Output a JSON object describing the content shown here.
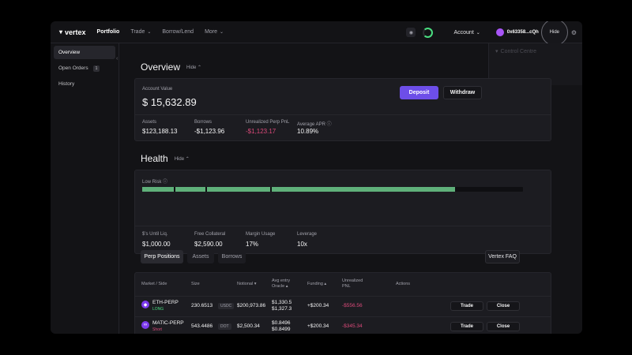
{
  "logo": "vertex",
  "nav": {
    "portfolio": "Portfolio",
    "trade": "Trade",
    "borrow_lend": "Borrow/Lend",
    "more": "More"
  },
  "header": {
    "account": "Account",
    "wallet": "0x63358...cQh",
    "hide": "Hide"
  },
  "dropdown": {
    "control_centre": "Control Centre"
  },
  "sidebar": {
    "items": [
      {
        "label": "Overview"
      },
      {
        "label": "Open Orders",
        "badge": "1"
      },
      {
        "label": "History"
      }
    ]
  },
  "overview": {
    "title": "Overview",
    "hide": "Hide",
    "account_value_label": "Account Value",
    "account_value": "$ 15,632.89",
    "deposit": "Deposit",
    "withdraw": "Withdraw",
    "stats": [
      {
        "label": "Assets",
        "value": "$123,188.13"
      },
      {
        "label": "Borrows",
        "value": "-$1,123.96"
      },
      {
        "label": "Unrealized Perp PnL",
        "value": "-$1,123.17"
      },
      {
        "label": "Average APR",
        "value": "10.89%"
      }
    ]
  },
  "health": {
    "title": "Health",
    "hide": "Hide",
    "risk_label": "Low Risk",
    "stats": [
      {
        "label": "$'s Until Liq.",
        "value": "$1,000.00"
      },
      {
        "label": "Free Collateral",
        "value": "$2,590.00"
      },
      {
        "label": "Margin Usage",
        "value": "17%"
      },
      {
        "label": "Leverage",
        "value": "10x"
      }
    ]
  },
  "tabs": {
    "perp": "Perp Positions",
    "assets": "Assets",
    "borrows": "Borrows",
    "faq": "Vertex FAQ"
  },
  "table": {
    "headers": {
      "market": "Market / Side",
      "size": "Size",
      "notional": "Notional",
      "avg_entry": "Avg entry",
      "oracle": "Oracle",
      "funding": "Funding",
      "unrealized": "Unrealized",
      "pnl": "PNL",
      "actions": "Actions"
    },
    "rows": [
      {
        "market": "ETH-PERP",
        "side": "LONG",
        "size": "230.6513",
        "unit": "USDC",
        "notional": "$200,973.86",
        "entry": "$1,330.5",
        "oracle": "$1,327.3",
        "funding": "+$200.34",
        "pnl": "-$556.56",
        "trade": "Trade",
        "close": "Close"
      },
      {
        "market": "MATIC-PERP",
        "side": "Short",
        "size": "543.4486",
        "unit": "DOT",
        "notional": "$2,500.34",
        "entry": "$0.8496",
        "oracle": "$0.8499",
        "funding": "+$200.34",
        "pnl": "-$345.34",
        "trade": "Trade",
        "close": "Close"
      }
    ]
  },
  "colors": {
    "accent": "#6d4ee8",
    "health_bar": "#5fb07a",
    "negative": "#dc4a7a",
    "long": "#4ade80"
  }
}
